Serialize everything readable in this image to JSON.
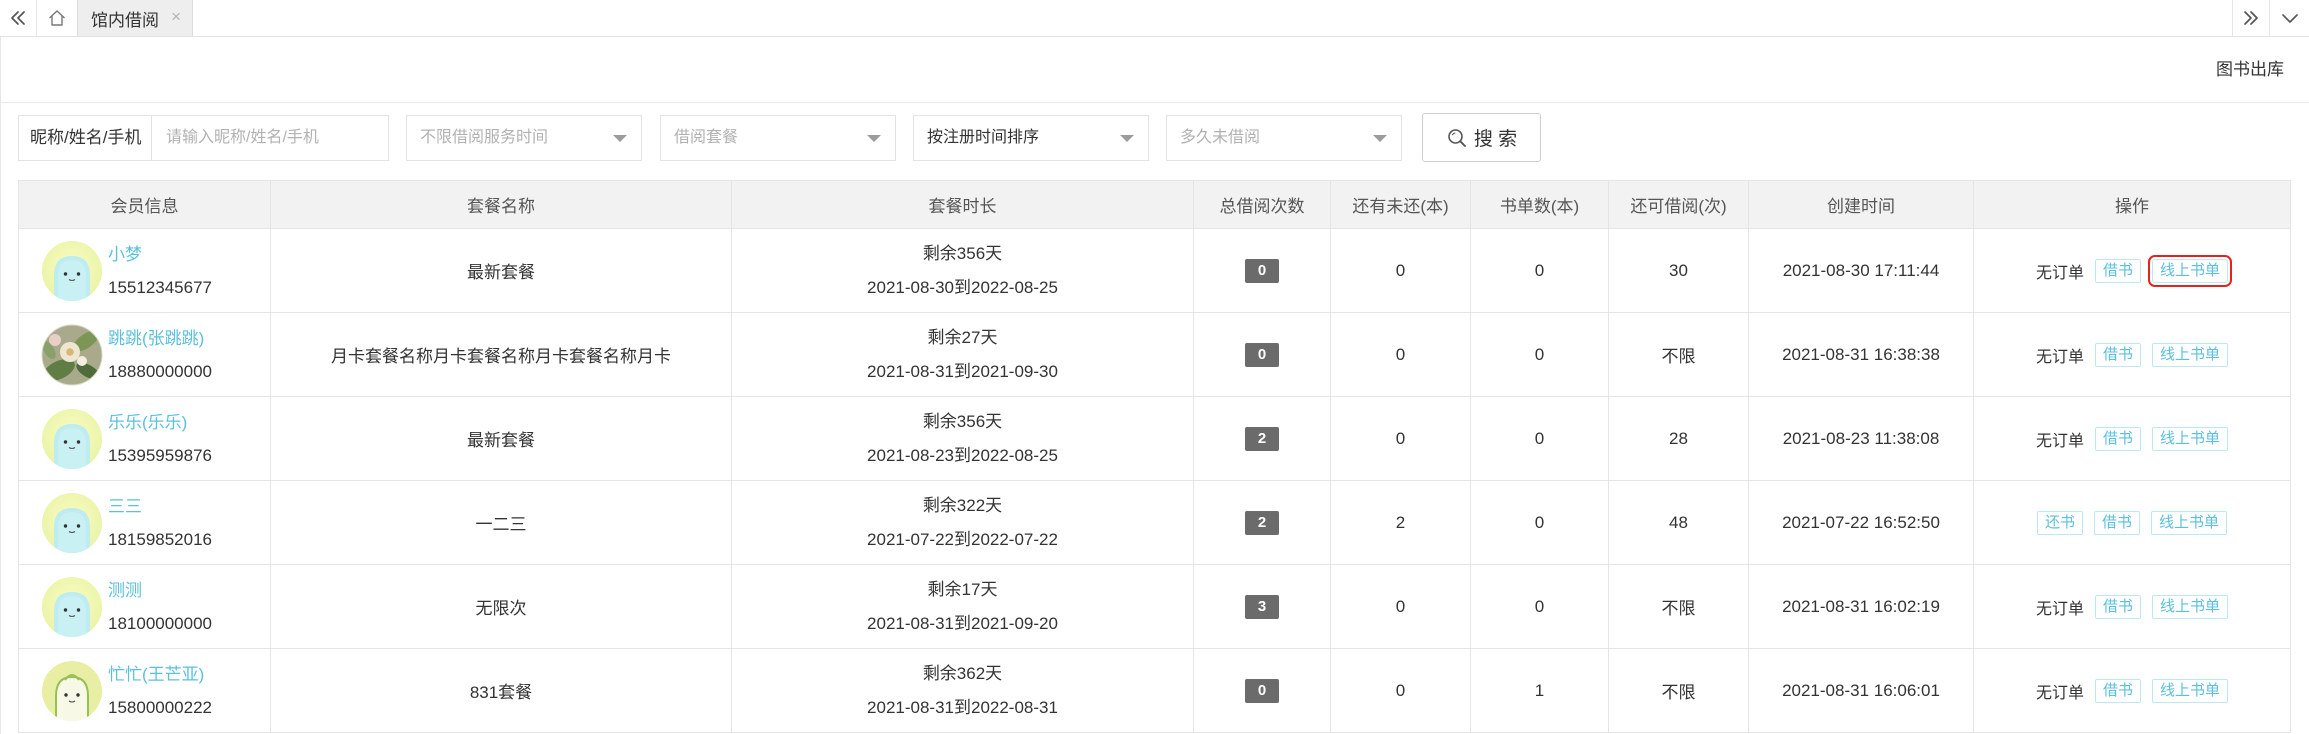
{
  "topbar": {
    "tabs": [
      {
        "label": "馆内借阅",
        "close": "×"
      }
    ],
    "icons": {
      "scroll_left": "double-chevron-left-icon",
      "home": "home-icon",
      "scroll_right": "double-chevron-right-icon",
      "menu": "chevron-down-icon"
    }
  },
  "toolbar": {
    "export_label": "图书出库"
  },
  "filters": {
    "search_label": "昵称/姓名/手机",
    "search_placeholder": "请输入昵称/姓名/手机",
    "service_time_placeholder": "不限借阅服务时间",
    "package_placeholder": "借阅套餐",
    "sort_value": "按注册时间排序",
    "inactive_placeholder": "多久未借阅",
    "search_button_label": "搜 索",
    "search_icon": "search-icon"
  },
  "table": {
    "columns": [
      "会员信息",
      "套餐名称",
      "套餐时长",
      "总借阅次数",
      "还有未还(本)",
      "书单数(本)",
      "还可借阅(次)",
      "创建时间",
      "操作"
    ],
    "rows": [
      {
        "avatar": "ghost-avatar-icon",
        "name": "小梦",
        "phone": "15512345677",
        "package": "最新套餐",
        "remaining": "剩余356天",
        "period": "2021-08-30到2022-08-25",
        "total_borrows": "0",
        "unreturned": "0",
        "booklists": "0",
        "borrows_left": "30",
        "created": "2021-08-30 17:11:44",
        "status": "无订单",
        "actions": [
          "借书",
          "线上书单"
        ],
        "online_booklist_highlighted": true
      },
      {
        "avatar": "flower-photo-avatar-icon",
        "name": "跳跳(张跳跳)",
        "phone": "18880000000",
        "package": "月卡套餐名称月卡套餐名称月卡套餐名称月卡",
        "remaining": "剩余27天",
        "period": "2021-08-31到2021-09-30",
        "total_borrows": "0",
        "unreturned": "0",
        "booklists": "0",
        "borrows_left": "不限",
        "created": "2021-08-31 16:38:38",
        "status": "无订单",
        "actions": [
          "借书",
          "线上书单"
        ]
      },
      {
        "avatar": "ghost-avatar-icon",
        "name": "乐乐(乐乐)",
        "phone": "15395959876",
        "package": "最新套餐",
        "remaining": "剩余356天",
        "period": "2021-08-23到2022-08-25",
        "total_borrows": "2",
        "unreturned": "0",
        "booklists": "0",
        "borrows_left": "28",
        "created": "2021-08-23 11:38:08",
        "status": "无订单",
        "actions": [
          "借书",
          "线上书单"
        ]
      },
      {
        "avatar": "ghost-avatar-icon",
        "name": "三三",
        "phone": "18159852016",
        "package": "一二三",
        "remaining": "剩余322天",
        "period": "2021-07-22到2022-07-22",
        "total_borrows": "2",
        "unreturned": "2",
        "booklists": "0",
        "borrows_left": "48",
        "created": "2021-07-22 16:52:50",
        "actions": [
          "还书",
          "借书",
          "线上书单"
        ]
      },
      {
        "avatar": "ghost-avatar-icon",
        "name": "测测",
        "phone": "18100000000",
        "package": "无限次",
        "remaining": "剩余17天",
        "period": "2021-08-31到2021-09-20",
        "total_borrows": "3",
        "unreturned": "0",
        "booklists": "0",
        "borrows_left": "不限",
        "created": "2021-08-31 16:02:19",
        "status": "无订单",
        "actions": [
          "借书",
          "线上书单"
        ]
      },
      {
        "avatar": "leaf-figure-avatar-icon",
        "name": "忙忙(王芒亚)",
        "phone": "15800000222",
        "package": "831套餐",
        "remaining": "剩余362天",
        "period": "2021-08-31到2022-08-31",
        "total_borrows": "0",
        "unreturned": "0",
        "booklists": "1",
        "borrows_left": "不限",
        "created": "2021-08-31 16:06:01",
        "status": "无订单",
        "actions": [
          "借书",
          "线上书单"
        ]
      }
    ]
  },
  "colors": {
    "link": "#5bc0de",
    "badge_bg": "#6b6b6b",
    "action_border": "#bde8f1",
    "highlight_border": "#e3231e",
    "header_bg": "#f2f2f2"
  }
}
